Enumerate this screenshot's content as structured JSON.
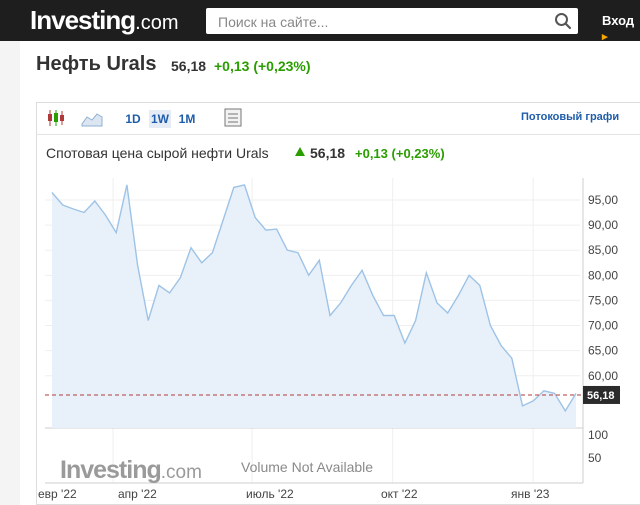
{
  "header": {
    "logo_main": "Investing",
    "logo_suffix": ".com",
    "search_placeholder": "Поиск на сайте...",
    "login": "Вход"
  },
  "instrument": {
    "title": "Нефть Urals",
    "price": "56,18",
    "change": "+0,13",
    "change_pct": "(+0,23%)"
  },
  "toolbar": {
    "intervals": [
      "1D",
      "1W",
      "1M"
    ],
    "active_interval": "1W",
    "streaming_label": "Потоковый графи"
  },
  "chart_header": {
    "title": "Спотовая цена сырой нефти Urals",
    "price": "56,18",
    "change": "+0,13",
    "change_pct": "(+0,23%)"
  },
  "watermark": {
    "main": "Investing",
    "suffix": ".com",
    "no_volume": "Volume Not Available"
  },
  "colors": {
    "positive": "#2a9d00",
    "line": "#9ec3e6",
    "area": "#e8f1fa",
    "current_price_line": "#b03a3a",
    "price_label_bg": "#2b2b2b"
  },
  "chart_data": {
    "type": "area",
    "x": [
      "2022-02-20",
      "2022-02-27",
      "2022-03-06",
      "2022-03-13",
      "2022-03-20",
      "2022-03-27",
      "2022-04-03",
      "2022-04-10",
      "2022-04-17",
      "2022-04-24",
      "2022-05-01",
      "2022-05-08",
      "2022-05-15",
      "2022-05-22",
      "2022-05-29",
      "2022-06-05",
      "2022-06-12",
      "2022-06-19",
      "2022-06-26",
      "2022-07-03",
      "2022-07-10",
      "2022-07-17",
      "2022-07-24",
      "2022-07-31",
      "2022-08-07",
      "2022-08-14",
      "2022-08-21",
      "2022-08-28",
      "2022-09-04",
      "2022-09-11",
      "2022-09-18",
      "2022-09-25",
      "2022-10-02",
      "2022-10-09",
      "2022-10-16",
      "2022-10-23",
      "2022-10-30",
      "2022-11-06",
      "2022-11-13",
      "2022-11-20",
      "2022-11-27",
      "2022-12-04",
      "2022-12-11",
      "2022-12-18",
      "2022-12-25",
      "2023-01-01",
      "2023-01-08",
      "2023-01-15",
      "2023-01-22",
      "2023-01-29"
    ],
    "values": [
      96.5,
      94.0,
      93.2,
      92.5,
      94.8,
      92.0,
      88.5,
      98.0,
      82.0,
      71.0,
      78.0,
      76.5,
      79.5,
      85.5,
      82.5,
      84.5,
      91.0,
      97.5,
      98.0,
      91.5,
      89.0,
      89.2,
      85.0,
      84.5,
      80.0,
      83.0,
      72.0,
      74.5,
      78.0,
      81.0,
      76.0,
      72.0,
      72.0,
      66.5,
      71.0,
      80.5,
      74.5,
      72.5,
      76.0,
      80.0,
      78.0,
      70.0,
      66.0,
      63.5,
      54.0,
      55.0,
      57.0,
      56.5,
      53.0,
      56.5
    ],
    "x_ticks": [
      "евр '22",
      "апр '22",
      "июль '22",
      "окт '22",
      "янв '23"
    ],
    "y_ticks": [
      60,
      65,
      70,
      75,
      80,
      85,
      90,
      95
    ],
    "y_tick_labels": [
      "60,00",
      "65,00",
      "70,00",
      "75,00",
      "80,00",
      "85,00",
      "90,00",
      "95,00"
    ],
    "ylim": [
      50,
      98
    ],
    "current_value": 56.18,
    "current_label": "56,18",
    "volume_ticks": [
      "100",
      "50"
    ]
  }
}
